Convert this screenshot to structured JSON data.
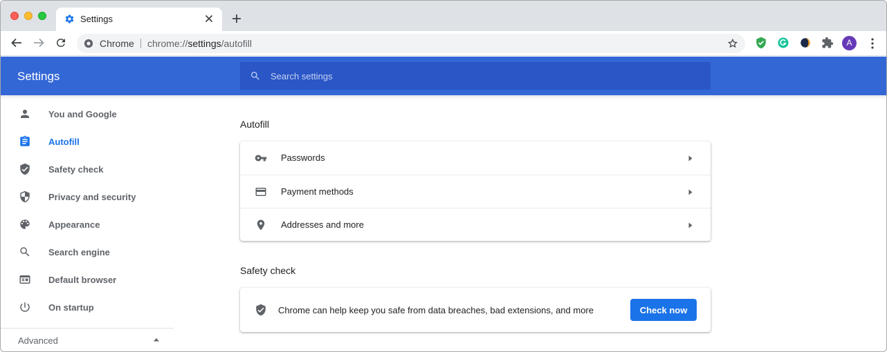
{
  "browser": {
    "tab_title": "Settings",
    "omnibox": {
      "origin_label": "Chrome",
      "url_prefix": "chrome://",
      "url_host": "settings",
      "url_path": "/autofill"
    },
    "profile_initial": "A"
  },
  "settings": {
    "header_title": "Settings",
    "search_placeholder": "Search settings",
    "sidebar": {
      "items": [
        {
          "label": "You and Google",
          "icon": "person-icon"
        },
        {
          "label": "Autofill",
          "icon": "clipboard-icon",
          "active": true
        },
        {
          "label": "Safety check",
          "icon": "shield-check-icon"
        },
        {
          "label": "Privacy and security",
          "icon": "shield-half-icon"
        },
        {
          "label": "Appearance",
          "icon": "palette-icon"
        },
        {
          "label": "Search engine",
          "icon": "search-icon"
        },
        {
          "label": "Default browser",
          "icon": "browser-window-icon"
        },
        {
          "label": "On startup",
          "icon": "power-icon"
        }
      ],
      "advanced_label": "Advanced"
    },
    "autofill": {
      "title": "Autofill",
      "rows": [
        {
          "label": "Passwords",
          "icon": "key-icon"
        },
        {
          "label": "Payment methods",
          "icon": "credit-card-icon"
        },
        {
          "label": "Addresses and more",
          "icon": "location-pin-icon"
        }
      ]
    },
    "safety_check": {
      "title": "Safety check",
      "description": "Chrome can help keep you safe from data breaches, bad extensions, and more",
      "button_label": "Check now"
    }
  },
  "colors": {
    "header_blue": "#3367d6",
    "search_blue": "#2a56c6",
    "accent_blue": "#1a73e8",
    "icon_grey": "#5f6368"
  }
}
